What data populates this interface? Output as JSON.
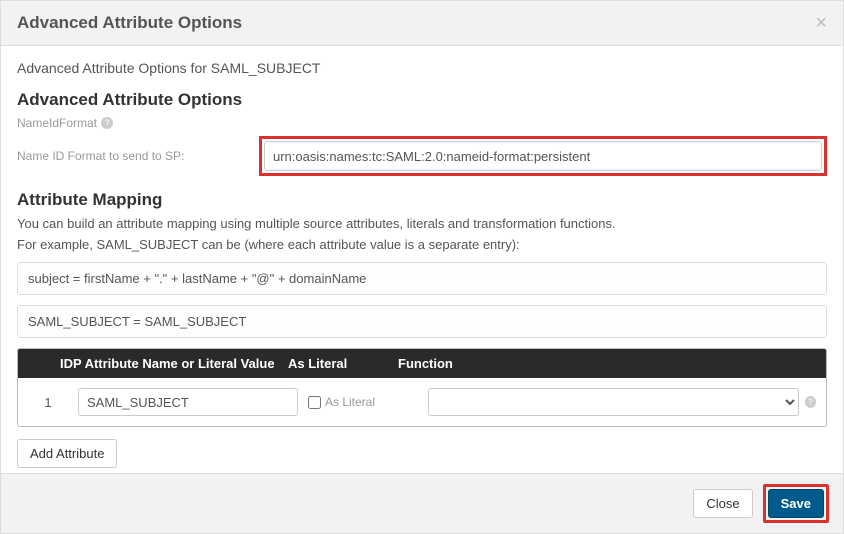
{
  "modal": {
    "title": "Advanced Attribute Options",
    "close_glyph": "×",
    "subtitle": "Advanced Attribute Options for SAML_SUBJECT"
  },
  "options": {
    "heading": "Advanced Attribute Options",
    "nameid_label": "NameIdFormat",
    "nameid_row_label": "Name ID Format to send to SP:",
    "nameid_value": "urn:oasis:names:tc:SAML:2.0:nameid-format:persistent"
  },
  "mapping": {
    "heading": "Attribute Mapping",
    "description1": "You can build an attribute mapping using multiple source attributes, literals and transformation functions.",
    "description2": "For example, SAML_SUBJECT can be (where each attribute value is a separate entry):",
    "example1": "subject = firstName + \".\" + lastName + \"@\" + domainName",
    "example2": "SAML_SUBJECT = SAML_SUBJECT",
    "columns": {
      "attr": "IDP Attribute Name or Literal Value",
      "literal": "As Literal",
      "func": "Function"
    },
    "rows": [
      {
        "index": "1",
        "attr_value": "SAML_SUBJECT",
        "as_literal_label": "As Literal",
        "as_literal_checked": false,
        "function_value": ""
      }
    ],
    "add_button": "Add Attribute"
  },
  "footer": {
    "close": "Close",
    "save": "Save"
  }
}
